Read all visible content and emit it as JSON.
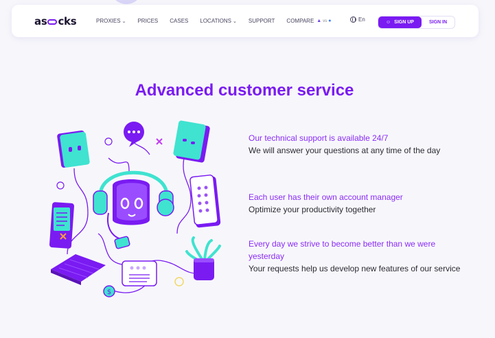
{
  "brand": {
    "logo_prefix": "as",
    "logo_suffix": "cks"
  },
  "nav": {
    "items": [
      {
        "label": "PROXIES",
        "dropdown": true
      },
      {
        "label": "PRICES",
        "dropdown": false
      },
      {
        "label": "CASES",
        "dropdown": false
      },
      {
        "label": "LOCATIONS",
        "dropdown": true
      },
      {
        "label": "SUPPORT",
        "dropdown": false
      },
      {
        "label": "COMPARE",
        "dropdown": false
      }
    ],
    "compare_vs": "vs",
    "language": "En",
    "signup_label": "SIGN UP",
    "signin_label": "SIGN IN"
  },
  "section": {
    "title": "Advanced customer service",
    "features": [
      {
        "heading": "Our technical support is available 24/7",
        "body": "We will answer your questions at any time of the day"
      },
      {
        "heading": "Each user has their own account manager",
        "body": "Optimize your productivity together"
      },
      {
        "heading": "Every day we strive to become better than we were yesterday",
        "body": "Your requests help us develop new features of our service"
      }
    ]
  },
  "colors": {
    "accent": "#7a1bf2",
    "teal": "#3fe3d0",
    "background": "#f7f7fb"
  },
  "icons": [
    "chevron-down-icon",
    "globe-icon",
    "user-icon",
    "support-robot-icon",
    "chat-bubble-icon",
    "dollar-icon"
  ]
}
